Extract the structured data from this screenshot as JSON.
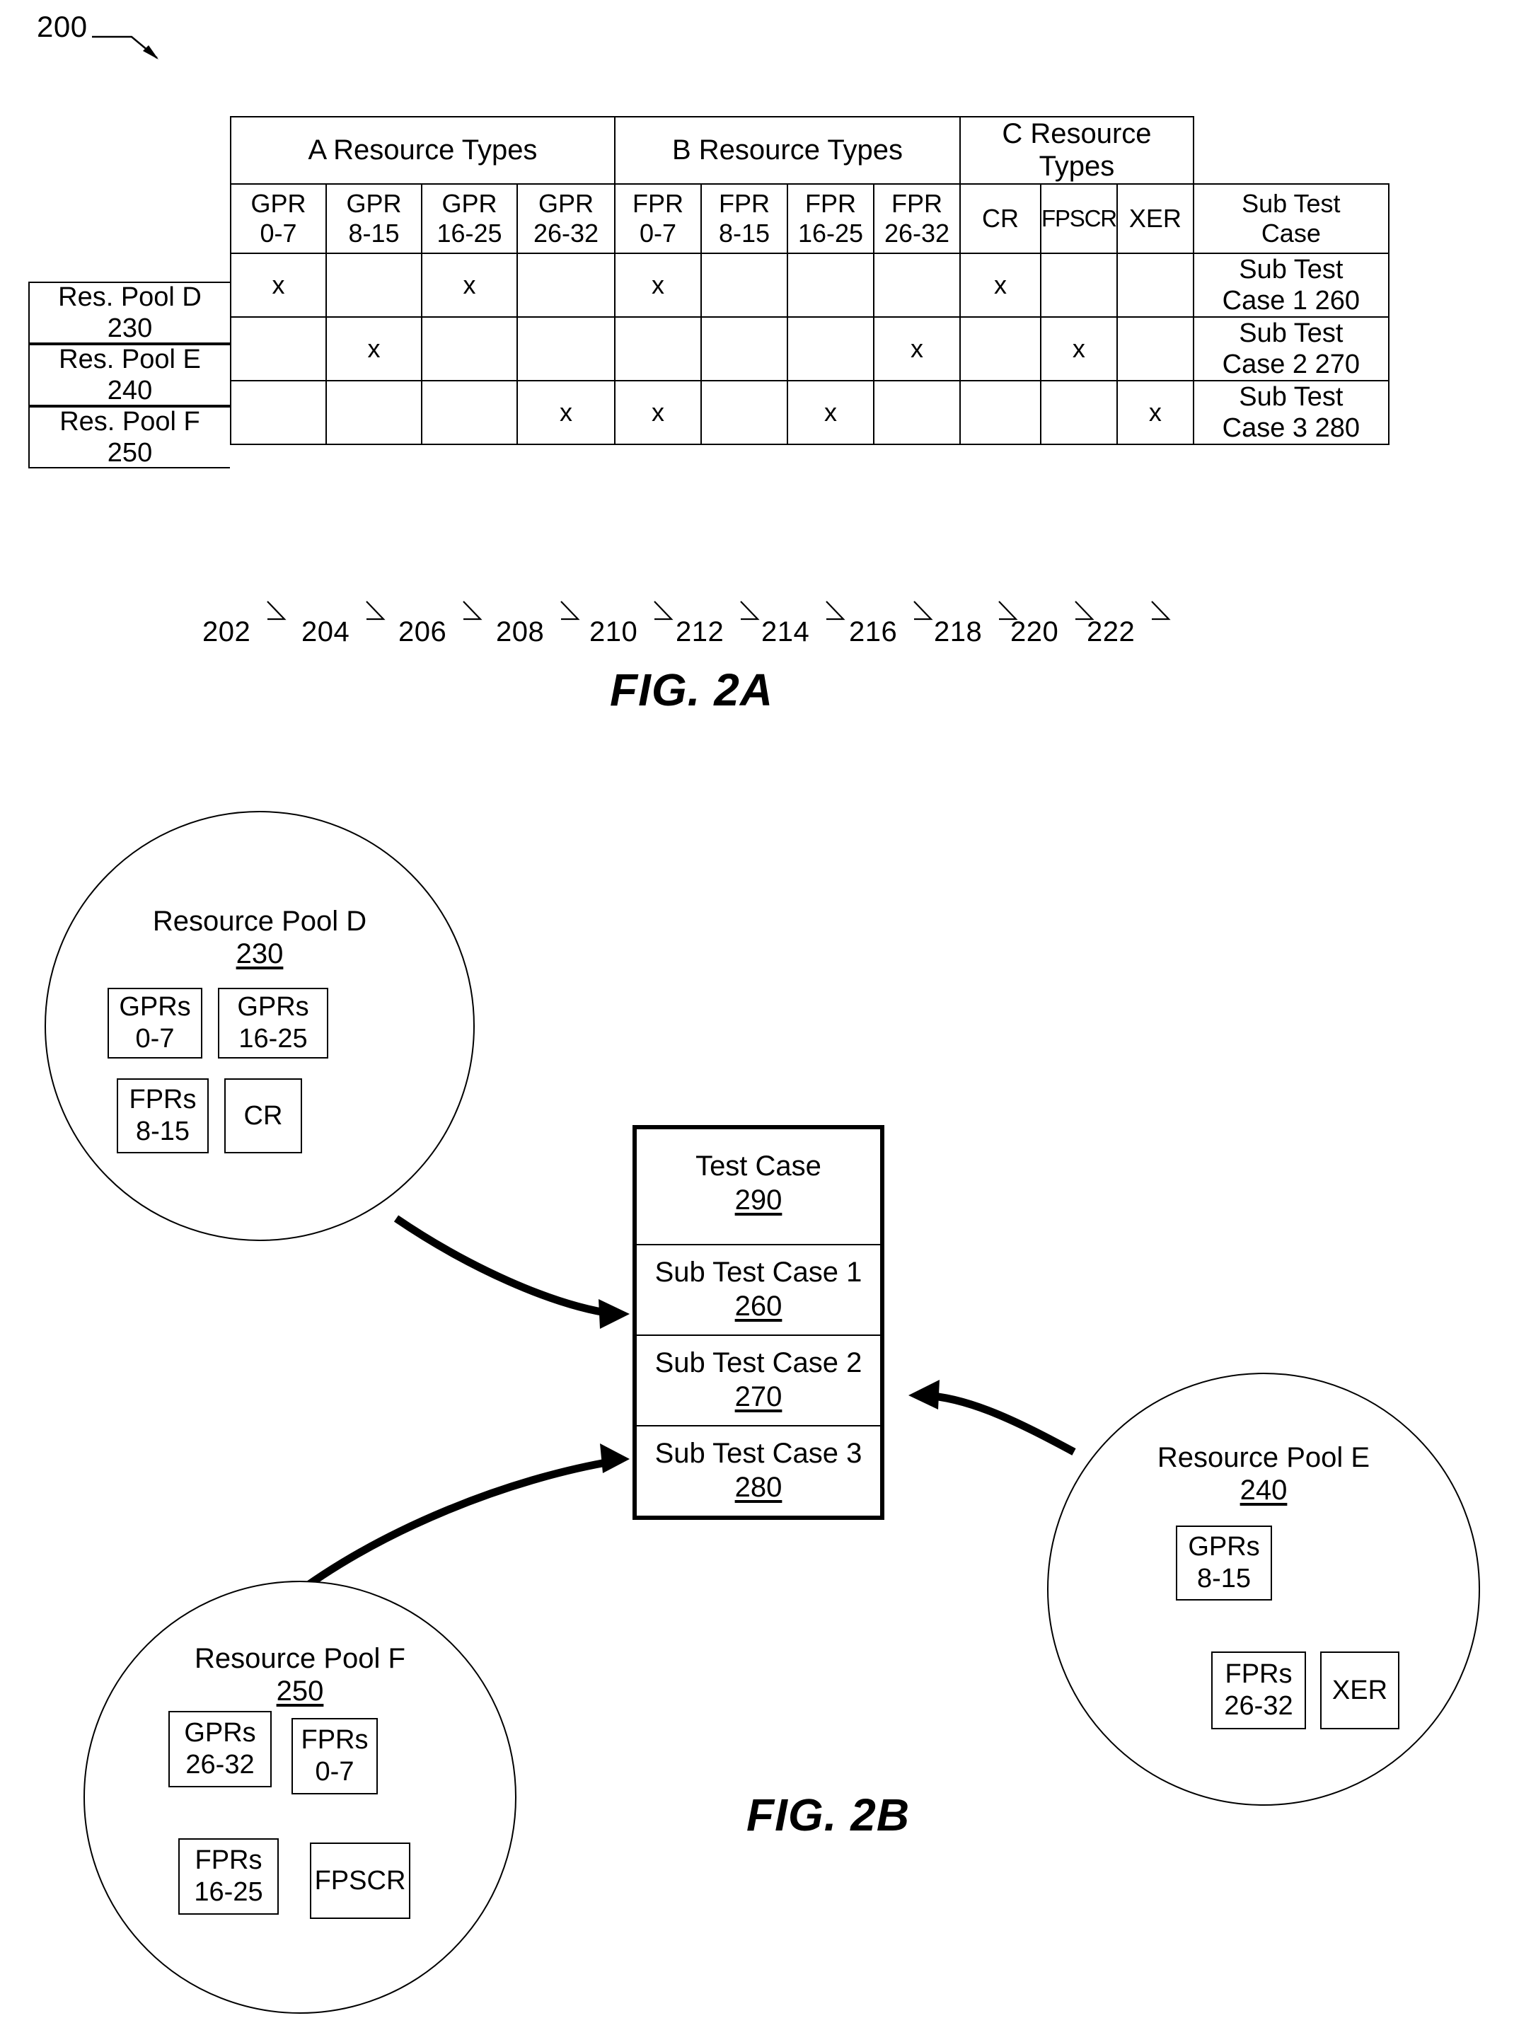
{
  "figure": {
    "number_label": "200",
    "caption_2a": "FIG. 2A",
    "caption_2b": "FIG. 2B"
  },
  "table_2a": {
    "groups": [
      {
        "label": "A Resource Types",
        "span": 4
      },
      {
        "label": "B Resource Types",
        "span": 4
      },
      {
        "label": "C Resource Types",
        "span": 3
      }
    ],
    "columns": [
      {
        "line1": "GPR",
        "line2": "0-7",
        "ref": "202"
      },
      {
        "line1": "GPR",
        "line2": "8-15",
        "ref": "204"
      },
      {
        "line1": "GPR",
        "line2": "16-25",
        "ref": "206"
      },
      {
        "line1": "GPR",
        "line2": "26-32",
        "ref": "208"
      },
      {
        "line1": "FPR",
        "line2": "0-7",
        "ref": "210"
      },
      {
        "line1": "FPR",
        "line2": "8-15",
        "ref": "212"
      },
      {
        "line1": "FPR",
        "line2": "16-25",
        "ref": "214"
      },
      {
        "line1": "FPR",
        "line2": "26-32",
        "ref": "216"
      },
      {
        "line1": "CR",
        "line2": "",
        "ref": "218"
      },
      {
        "line1": "FPSCR",
        "line2": "",
        "ref": "220"
      },
      {
        "line1": "XER",
        "line2": "",
        "ref": "222"
      }
    ],
    "last_column_header": {
      "line1": "Sub Test",
      "line2": "Case"
    },
    "mark": "x",
    "rows": [
      {
        "label_line1": "Res. Pool D",
        "label_line2": "230",
        "marks": [
          true,
          false,
          true,
          false,
          true,
          false,
          false,
          false,
          true,
          false,
          false
        ],
        "result_line1": "Sub Test",
        "result_line2": "Case 1 260"
      },
      {
        "label_line1": "Res. Pool E",
        "label_line2": "240",
        "marks": [
          false,
          true,
          false,
          false,
          false,
          false,
          false,
          true,
          false,
          true,
          false
        ],
        "result_line1": "Sub Test",
        "result_line2": "Case 2 270"
      },
      {
        "label_line1": "Res. Pool F",
        "label_line2": "250",
        "marks": [
          false,
          false,
          false,
          true,
          true,
          false,
          true,
          false,
          false,
          false,
          true
        ],
        "result_line1": "Sub Test",
        "result_line2": "Case 3 280"
      }
    ]
  },
  "figure_2b": {
    "pools": [
      {
        "id": "d",
        "title": "Resource Pool D",
        "number": "230",
        "resources": [
          {
            "line1": "GPRs",
            "line2": "0-7"
          },
          {
            "line1": "GPRs",
            "line2": "16-25"
          },
          {
            "line1": "FPRs",
            "line2": "8-15"
          },
          {
            "line1": "CR",
            "line2": ""
          }
        ]
      },
      {
        "id": "e",
        "title": "Resource Pool E",
        "number": "240",
        "resources": [
          {
            "line1": "GPRs",
            "line2": "8-15"
          },
          {
            "line1": "FPRs",
            "line2": "26-32"
          },
          {
            "line1": "XER",
            "line2": ""
          }
        ]
      },
      {
        "id": "f",
        "title": "Resource Pool F",
        "number": "250",
        "resources": [
          {
            "line1": "GPRs",
            "line2": "26-32"
          },
          {
            "line1": "FPRs",
            "line2": "0-7"
          },
          {
            "line1": "FPRs",
            "line2": "16-25"
          },
          {
            "line1": "FPSCR",
            "line2": ""
          }
        ]
      }
    ],
    "test_case": {
      "title": "Test Case",
      "number": "290",
      "sub_cases": [
        {
          "title": "Sub Test Case 1",
          "number": "260"
        },
        {
          "title": "Sub Test Case 2",
          "number": "270"
        },
        {
          "title": "Sub Test Case 3",
          "number": "280"
        }
      ]
    }
  }
}
